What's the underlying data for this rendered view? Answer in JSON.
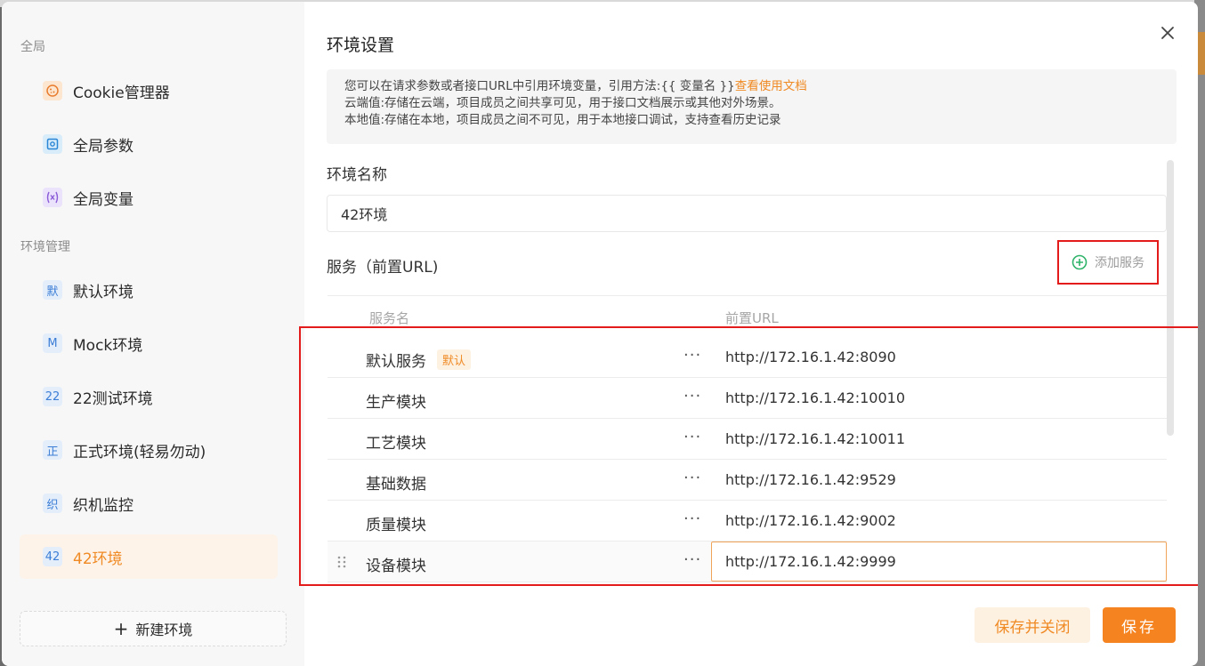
{
  "sidebar": {
    "group_global": "全局",
    "global_items": [
      {
        "label": "Cookie管理器",
        "icon": "cookie-icon"
      },
      {
        "label": "全局参数",
        "icon": "global-params-icon"
      },
      {
        "label": "全局变量",
        "icon": "variable-icon"
      }
    ],
    "group_env": "环境管理",
    "env_items": [
      {
        "label": "默认环境",
        "abbr": "默"
      },
      {
        "label": "Mock环境",
        "abbr": "M"
      },
      {
        "label": "22测试环境",
        "abbr": "22"
      },
      {
        "label": "正式环境(轻易勿动)",
        "abbr": "正"
      },
      {
        "label": "织机监控",
        "abbr": "织"
      },
      {
        "label": "42环境",
        "abbr": "42",
        "active": true
      }
    ],
    "new_env_label": "新建环境"
  },
  "dialog": {
    "title": "环境设置",
    "info_line1": "您可以在请求参数或者接口URL中引用环境变量，引用方法:{{ 变量名 }}",
    "info_link": "查看使用文档",
    "info_line2": "云端值:存储在云端，项目成员之间共享可见，用于接口文档展示或其他对外场景。",
    "info_line3": "本地值:存储在本地，项目成员之间不可见，用于本地接口调试，支持查看历史记录",
    "env_name_label": "环境名称",
    "env_name_value": "42环境",
    "services_label": "服务（前置URL)",
    "add_service_label": "添加服务",
    "table_header_name": "服务名",
    "table_header_url": "前置URL",
    "services": [
      {
        "name": "默认服务",
        "badge": "默认",
        "url": "http://172.16.1.42:8090"
      },
      {
        "name": "生产模块",
        "url": "http://172.16.1.42:10010"
      },
      {
        "name": "工艺模块",
        "url": "http://172.16.1.42:10011"
      },
      {
        "name": "基础数据",
        "url": "http://172.16.1.42:9529"
      },
      {
        "name": "质量模块",
        "url": "http://172.16.1.42:9002"
      },
      {
        "name": "设备模块",
        "url": "http://172.16.1.42:9999"
      }
    ],
    "more_label": "···",
    "save_close_label": "保存并关闭",
    "save_label": "保存"
  },
  "colors": {
    "accent": "#f5831f",
    "highlight_box": "#e31b1b"
  }
}
